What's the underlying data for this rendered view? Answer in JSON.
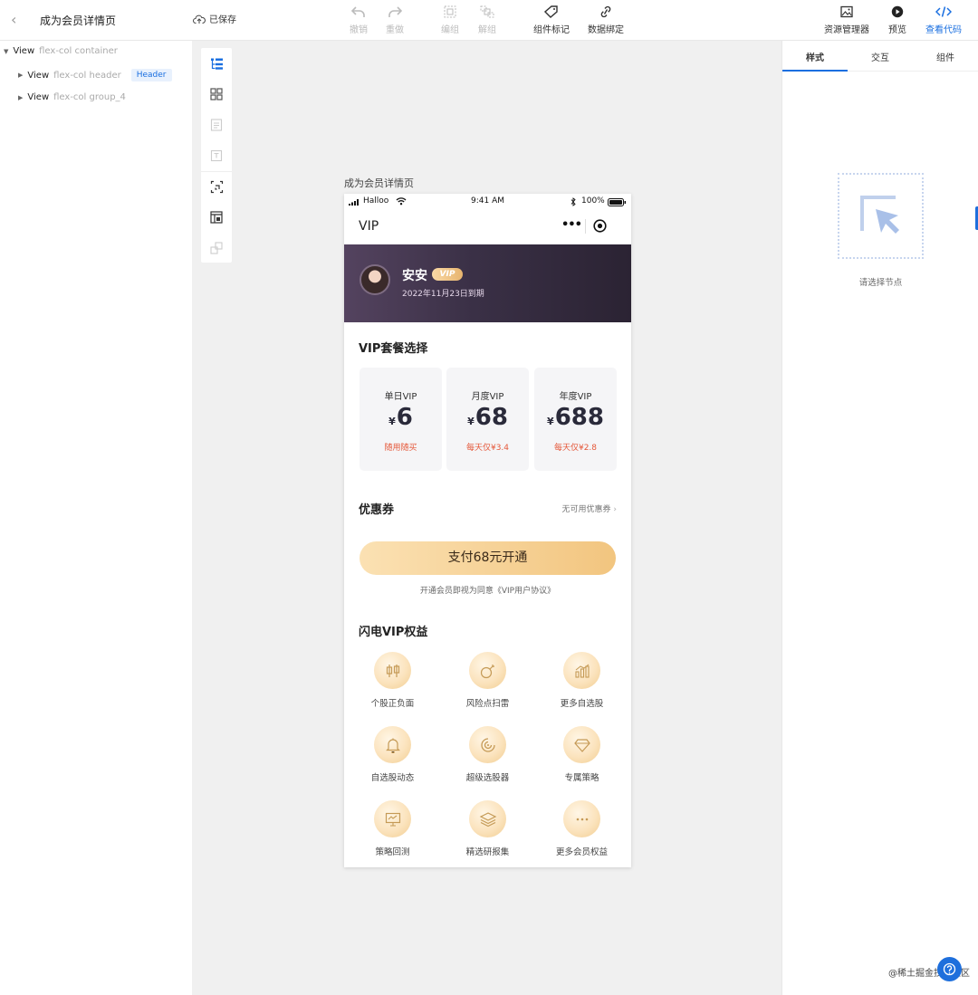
{
  "header": {
    "page_name": "成为会员详情页",
    "saved_label": "已保存",
    "tools": {
      "undo": "撤销",
      "redo": "重做",
      "group": "编组",
      "ungroup": "解组",
      "component_mark": "组件标记",
      "data_binding": "数据绑定",
      "resource_manager": "资源管理器",
      "preview": "预览",
      "view_code": "查看代码"
    }
  },
  "tree": {
    "root": {
      "tag": "View",
      "cls": "flex-col container"
    },
    "children": [
      {
        "tag": "View",
        "cls": "flex-col header",
        "badge": "Header"
      },
      {
        "tag": "View",
        "cls": "flex-col group_4"
      }
    ]
  },
  "canvas": {
    "page_title": "成为会员详情页"
  },
  "phone": {
    "status": {
      "carrier": "Halloo",
      "time": "9:41 AM",
      "battery": "100%"
    },
    "nav": {
      "title": "VIP",
      "more": "•••"
    },
    "user": {
      "name": "安安",
      "badge": "VIP",
      "expire": "2022年11月23日到期"
    },
    "plans_title": "VIP套餐选择",
    "currency": "¥",
    "plans": [
      {
        "name": "单日VIP",
        "price": "6",
        "note": "随用随买"
      },
      {
        "name": "月度VIP",
        "price": "68",
        "note": "每天仅¥3.4"
      },
      {
        "name": "年度VIP",
        "price": "688",
        "note": "每天仅¥2.8"
      }
    ],
    "coupon": {
      "title": "优惠券",
      "link": "无可用优惠券"
    },
    "pay_button": "支付68元开通",
    "agreement": "开通会员即视为同意《VIP用户协议》",
    "benefits_title": "闪电VIP权益",
    "benefits": [
      {
        "label": "个股正负面",
        "icon": "candlestick-icon"
      },
      {
        "label": "风险点扫雷",
        "icon": "bomb-icon"
      },
      {
        "label": "更多自选股",
        "icon": "bar-chart-icon"
      },
      {
        "label": "自选股动态",
        "icon": "bell-icon"
      },
      {
        "label": "超级选股器",
        "icon": "spiral-icon"
      },
      {
        "label": "专属策略",
        "icon": "diamond-icon"
      },
      {
        "label": "策略回测",
        "icon": "monitor-icon"
      },
      {
        "label": "精选研报集",
        "icon": "layers-icon"
      },
      {
        "label": "更多会员权益",
        "icon": "more-icon"
      }
    ]
  },
  "right_panel": {
    "tabs": [
      "样式",
      "交互",
      "组件"
    ],
    "empty_text": "请选择节点"
  },
  "watermark": "@稀土掘金技术社区",
  "colors": {
    "accent": "#1a6fe0",
    "price_note": "#e5583a",
    "hero": "#3a3046",
    "gold": "#f2c57f"
  }
}
